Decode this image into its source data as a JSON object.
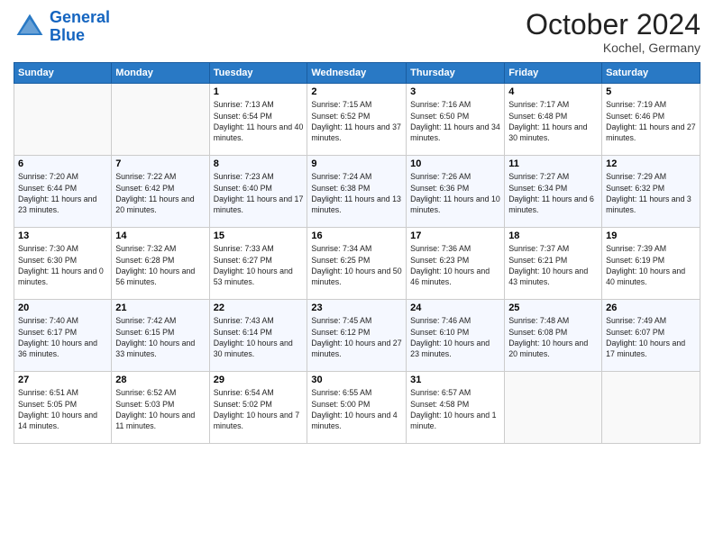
{
  "logo": {
    "line1": "General",
    "line2": "Blue"
  },
  "title": "October 2024",
  "location": "Kochel, Germany",
  "days_header": [
    "Sunday",
    "Monday",
    "Tuesday",
    "Wednesday",
    "Thursday",
    "Friday",
    "Saturday"
  ],
  "weeks": [
    [
      {
        "num": "",
        "info": ""
      },
      {
        "num": "",
        "info": ""
      },
      {
        "num": "1",
        "info": "Sunrise: 7:13 AM\nSunset: 6:54 PM\nDaylight: 11 hours and 40 minutes."
      },
      {
        "num": "2",
        "info": "Sunrise: 7:15 AM\nSunset: 6:52 PM\nDaylight: 11 hours and 37 minutes."
      },
      {
        "num": "3",
        "info": "Sunrise: 7:16 AM\nSunset: 6:50 PM\nDaylight: 11 hours and 34 minutes."
      },
      {
        "num": "4",
        "info": "Sunrise: 7:17 AM\nSunset: 6:48 PM\nDaylight: 11 hours and 30 minutes."
      },
      {
        "num": "5",
        "info": "Sunrise: 7:19 AM\nSunset: 6:46 PM\nDaylight: 11 hours and 27 minutes."
      }
    ],
    [
      {
        "num": "6",
        "info": "Sunrise: 7:20 AM\nSunset: 6:44 PM\nDaylight: 11 hours and 23 minutes."
      },
      {
        "num": "7",
        "info": "Sunrise: 7:22 AM\nSunset: 6:42 PM\nDaylight: 11 hours and 20 minutes."
      },
      {
        "num": "8",
        "info": "Sunrise: 7:23 AM\nSunset: 6:40 PM\nDaylight: 11 hours and 17 minutes."
      },
      {
        "num": "9",
        "info": "Sunrise: 7:24 AM\nSunset: 6:38 PM\nDaylight: 11 hours and 13 minutes."
      },
      {
        "num": "10",
        "info": "Sunrise: 7:26 AM\nSunset: 6:36 PM\nDaylight: 11 hours and 10 minutes."
      },
      {
        "num": "11",
        "info": "Sunrise: 7:27 AM\nSunset: 6:34 PM\nDaylight: 11 hours and 6 minutes."
      },
      {
        "num": "12",
        "info": "Sunrise: 7:29 AM\nSunset: 6:32 PM\nDaylight: 11 hours and 3 minutes."
      }
    ],
    [
      {
        "num": "13",
        "info": "Sunrise: 7:30 AM\nSunset: 6:30 PM\nDaylight: 11 hours and 0 minutes."
      },
      {
        "num": "14",
        "info": "Sunrise: 7:32 AM\nSunset: 6:28 PM\nDaylight: 10 hours and 56 minutes."
      },
      {
        "num": "15",
        "info": "Sunrise: 7:33 AM\nSunset: 6:27 PM\nDaylight: 10 hours and 53 minutes."
      },
      {
        "num": "16",
        "info": "Sunrise: 7:34 AM\nSunset: 6:25 PM\nDaylight: 10 hours and 50 minutes."
      },
      {
        "num": "17",
        "info": "Sunrise: 7:36 AM\nSunset: 6:23 PM\nDaylight: 10 hours and 46 minutes."
      },
      {
        "num": "18",
        "info": "Sunrise: 7:37 AM\nSunset: 6:21 PM\nDaylight: 10 hours and 43 minutes."
      },
      {
        "num": "19",
        "info": "Sunrise: 7:39 AM\nSunset: 6:19 PM\nDaylight: 10 hours and 40 minutes."
      }
    ],
    [
      {
        "num": "20",
        "info": "Sunrise: 7:40 AM\nSunset: 6:17 PM\nDaylight: 10 hours and 36 minutes."
      },
      {
        "num": "21",
        "info": "Sunrise: 7:42 AM\nSunset: 6:15 PM\nDaylight: 10 hours and 33 minutes."
      },
      {
        "num": "22",
        "info": "Sunrise: 7:43 AM\nSunset: 6:14 PM\nDaylight: 10 hours and 30 minutes."
      },
      {
        "num": "23",
        "info": "Sunrise: 7:45 AM\nSunset: 6:12 PM\nDaylight: 10 hours and 27 minutes."
      },
      {
        "num": "24",
        "info": "Sunrise: 7:46 AM\nSunset: 6:10 PM\nDaylight: 10 hours and 23 minutes."
      },
      {
        "num": "25",
        "info": "Sunrise: 7:48 AM\nSunset: 6:08 PM\nDaylight: 10 hours and 20 minutes."
      },
      {
        "num": "26",
        "info": "Sunrise: 7:49 AM\nSunset: 6:07 PM\nDaylight: 10 hours and 17 minutes."
      }
    ],
    [
      {
        "num": "27",
        "info": "Sunrise: 6:51 AM\nSunset: 5:05 PM\nDaylight: 10 hours and 14 minutes."
      },
      {
        "num": "28",
        "info": "Sunrise: 6:52 AM\nSunset: 5:03 PM\nDaylight: 10 hours and 11 minutes."
      },
      {
        "num": "29",
        "info": "Sunrise: 6:54 AM\nSunset: 5:02 PM\nDaylight: 10 hours and 7 minutes."
      },
      {
        "num": "30",
        "info": "Sunrise: 6:55 AM\nSunset: 5:00 PM\nDaylight: 10 hours and 4 minutes."
      },
      {
        "num": "31",
        "info": "Sunrise: 6:57 AM\nSunset: 4:58 PM\nDaylight: 10 hours and 1 minute."
      },
      {
        "num": "",
        "info": ""
      },
      {
        "num": "",
        "info": ""
      }
    ]
  ]
}
